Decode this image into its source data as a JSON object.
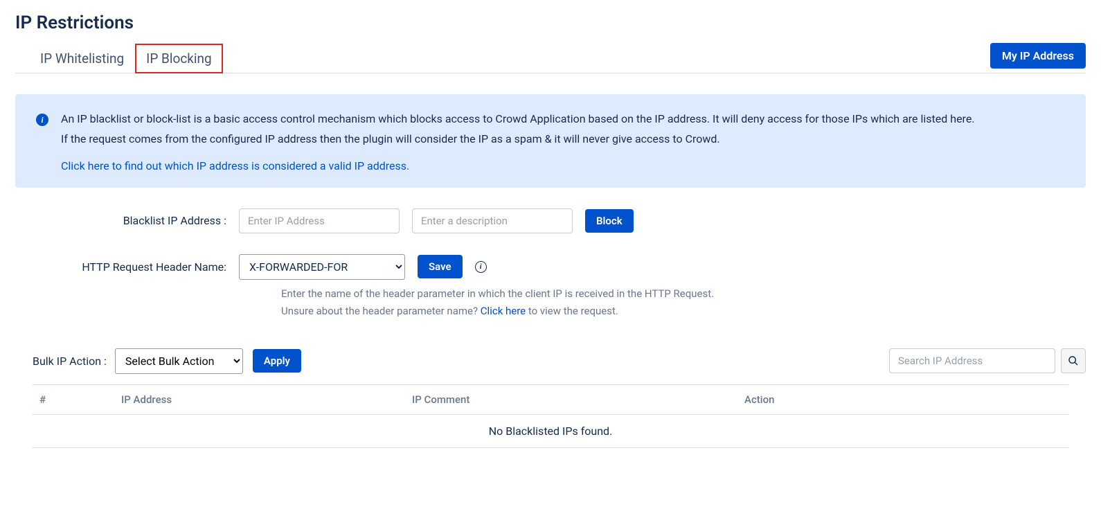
{
  "page_title": "IP Restrictions",
  "tabs": {
    "whitelisting": "IP Whitelisting",
    "blocking": "IP Blocking"
  },
  "my_ip_button": "My IP Address",
  "info": {
    "line1": "An IP blacklist or block-list is a basic access control mechanism which blocks access to Crowd Application based on the IP address. It will deny access for those IPs which are listed here.",
    "line2": "If the request comes from the configured IP address then the plugin will consider the IP as a spam & it will never give access to Crowd.",
    "link": "Click here to find out which IP address is considered a valid IP address."
  },
  "form": {
    "blacklist_label": "Blacklist IP Address :",
    "ip_placeholder": "Enter IP Address",
    "desc_placeholder": "Enter a description",
    "block_button": "Block",
    "header_label": "HTTP Request Header Name:",
    "header_value": "X-FORWARDED-FOR",
    "save_button": "Save",
    "helper_line1": "Enter the name of the header parameter in which the client IP is received in the HTTP Request.",
    "helper_line2a": "Unsure about the header parameter name? ",
    "helper_link": "Click here",
    "helper_line2b": " to view the request."
  },
  "bulk": {
    "label": "Bulk IP Action :",
    "select_value": "Select Bulk Action",
    "apply_button": "Apply",
    "search_placeholder": "Search IP Address"
  },
  "table": {
    "headers": {
      "num": "#",
      "ip": "IP Address",
      "comment": "IP Comment",
      "action": "Action"
    },
    "empty_message": "No Blacklisted IPs found."
  }
}
